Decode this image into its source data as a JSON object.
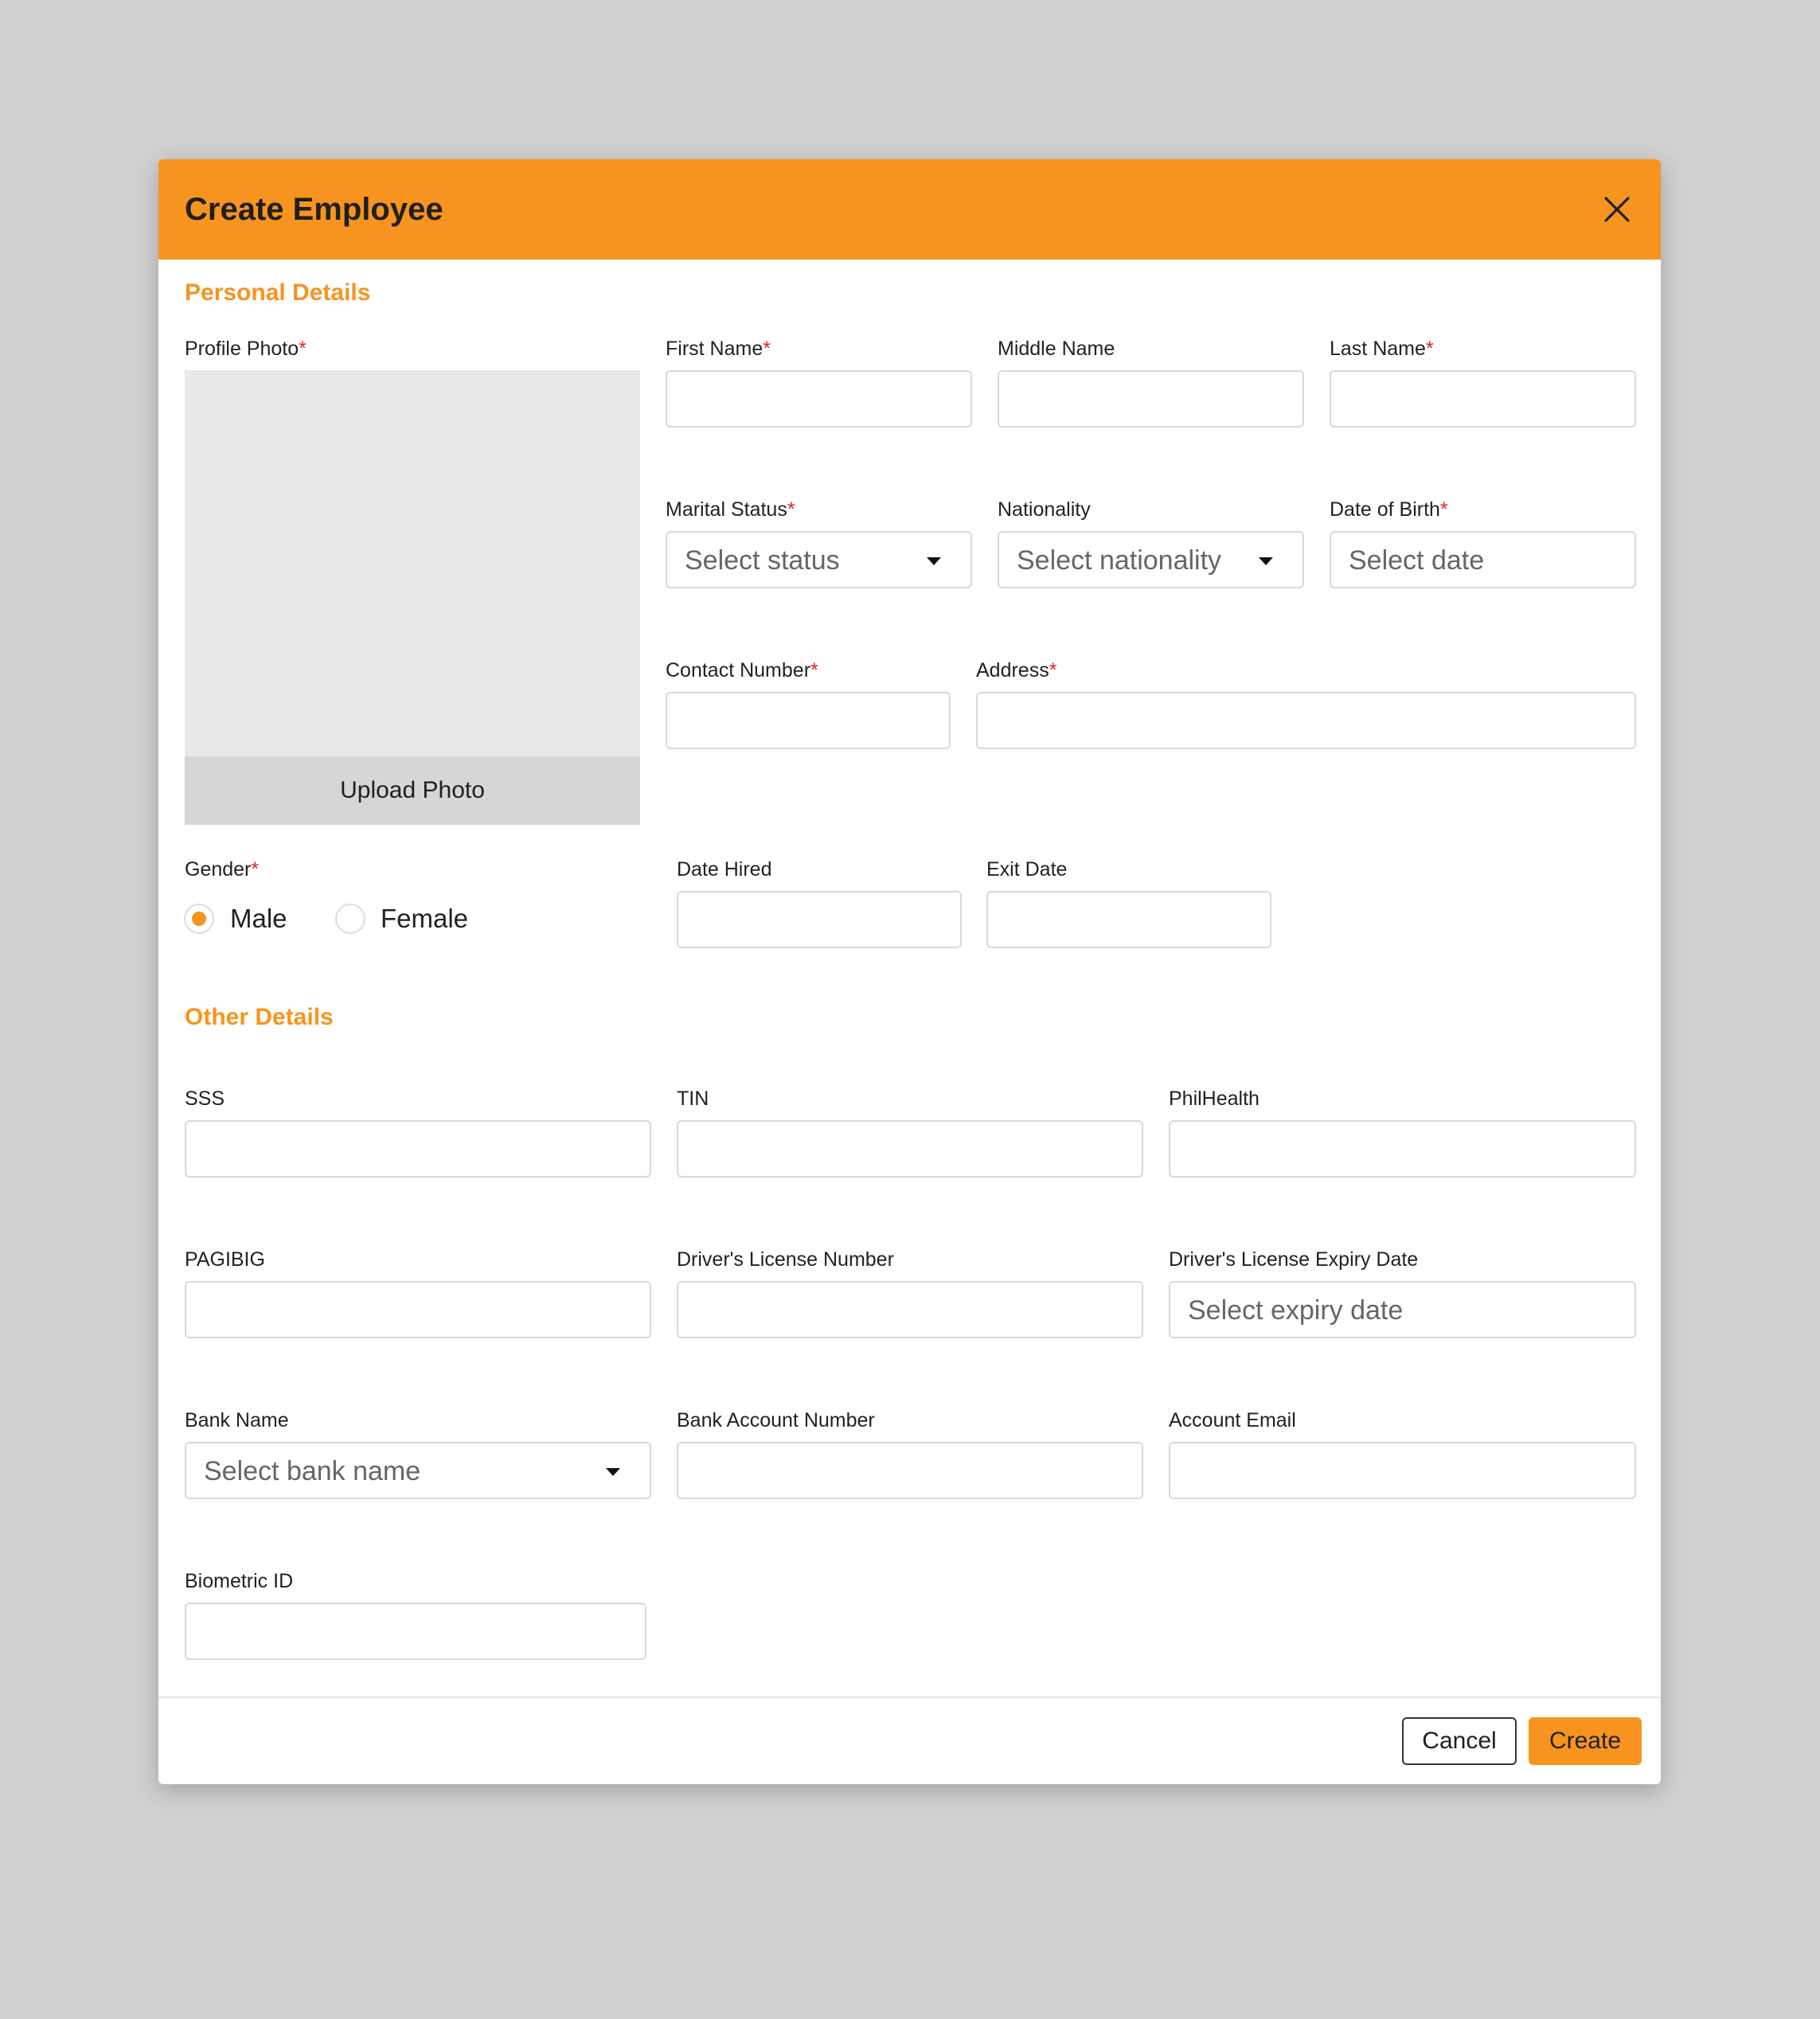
{
  "modal": {
    "title": "Create Employee",
    "close_icon": "close-icon"
  },
  "colors": {
    "accent": "#f7941f",
    "required": "#e02424",
    "backdrop": "#d0d0d0"
  },
  "personal": {
    "section_title": "Personal Details",
    "profile_photo_label": "Profile Photo",
    "upload_photo": "Upload Photo",
    "first_name_label": "First Name",
    "middle_name_label": "Middle Name",
    "last_name_label": "Last Name",
    "marital_status_label": "Marital Status",
    "marital_status_placeholder": "Select status",
    "nationality_label": "Nationality",
    "nationality_placeholder": "Select nationality",
    "dob_label": "Date of Birth",
    "dob_placeholder": "Select date",
    "contact_label": "Contact Number",
    "address_label": "Address",
    "gender_label": "Gender",
    "gender_options": [
      "Male",
      "Female"
    ],
    "gender_selected": "Male",
    "date_hired_label": "Date Hired",
    "exit_date_label": "Exit Date",
    "required_mark": "*"
  },
  "other": {
    "section_title": "Other Details",
    "sss_label": "SSS",
    "tin_label": "TIN",
    "philhealth_label": "PhilHealth",
    "pagibig_label": "PAGIBIG",
    "license_number_label": "Driver's License Number",
    "license_expiry_label": "Driver's License Expiry Date",
    "license_expiry_placeholder": "Select expiry date",
    "bank_name_label": "Bank Name",
    "bank_name_placeholder": "Select bank name",
    "bank_account_label": "Bank Account Number",
    "account_email_label": "Account Email",
    "biometric_label": "Biometric ID"
  },
  "footer": {
    "cancel_label": "Cancel",
    "create_label": "Create"
  }
}
